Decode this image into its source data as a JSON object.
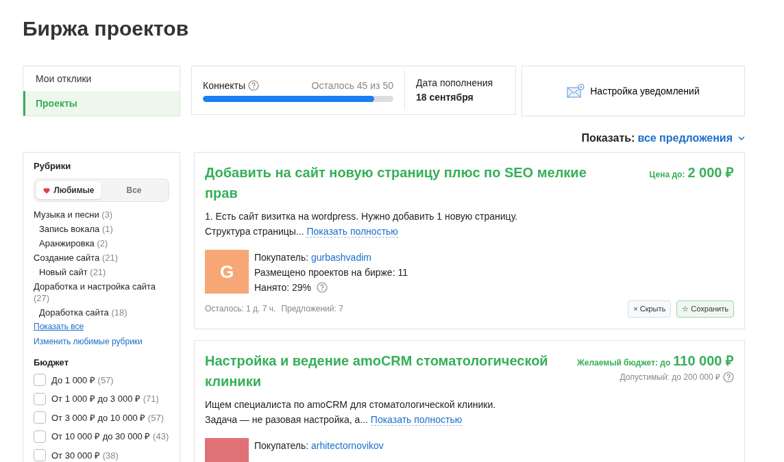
{
  "page_title": "Биржа проектов",
  "menu": [
    {
      "label": "Мои отклики",
      "selected": false
    },
    {
      "label": "Проекты",
      "selected": true
    }
  ],
  "connects": {
    "label": "Коннекты",
    "remaining_label": "Осталось",
    "remaining": "45 из 50",
    "level": 0.9
  },
  "refill": {
    "label": "Дата пополнения",
    "date": "18 сентября"
  },
  "notifications_button": {
    "label": "Настройка уведомлений"
  },
  "show_filter": {
    "label": "Показать:",
    "value": "все предложения"
  },
  "categories": {
    "title": "Рубрики",
    "toggle": [
      {
        "label": "Любимые",
        "selected": true
      },
      {
        "label": "Все",
        "selected": false
      }
    ],
    "items": [
      {
        "label": "Музыка и песни",
        "count": "(3)",
        "children": [
          {
            "label": "Запись вокала",
            "count": "(1)"
          },
          {
            "label": "Аранжировка",
            "count": "(2)"
          }
        ]
      },
      {
        "label": "Создание сайта",
        "count": "(21)",
        "children": [
          {
            "label": "Новый сайт",
            "count": "(21)"
          }
        ]
      },
      {
        "label": "Доработка и настройка сайта",
        "count": "(27)",
        "children": [
          {
            "label": "Доработка сайта",
            "count": "(18)"
          }
        ]
      }
    ],
    "show_all": "Показать все",
    "edit_link": "Изменить любимые рубрики"
  },
  "budget": {
    "title": "Бюджет",
    "options": [
      {
        "label": "До 1 000 ₽",
        "count": "(57)",
        "checked": false
      },
      {
        "label": "От 1 000 ₽ до 3 000 ₽",
        "count": "(71)",
        "checked": false
      },
      {
        "label": "От 3 000 ₽ до 10 000 ₽",
        "count": "(57)",
        "checked": false
      },
      {
        "label": "От 10 000 ₽ до 30 000 ₽",
        "count": "(43)",
        "checked": false
      },
      {
        "label": "От 30 000 ₽",
        "count": "(38)",
        "checked": false
      }
    ]
  },
  "projects": [
    {
      "title": "Добавить на сайт новую страницу плюс по SEO мелкие прав",
      "price_label": "Цена до:",
      "price": "2 000 ₽",
      "description": "1. Есть сайт визитка на wordpress. Нужно добавить 1 новую страницу.\nСтруктура страницы...",
      "more_link": "Показать полностью",
      "avatar_letter": "G",
      "color": "#f7a776",
      "buyer_label": "Покупатель:",
      "buyer": "gurbashvadim",
      "posted": "Размещено проектов на бирже: 11",
      "hired": "Нанято: 29%",
      "remaining": "Осталось: 1 д. 7 ч.",
      "offers": "Предложений: 7",
      "hide_button": "× Скрыть",
      "save_button": "☆ Сохранить"
    },
    {
      "title": "Настройка и ведение amoCRM стоматологической клиники",
      "price_label": "Желаемый бюджет: до",
      "price": "110 000 ₽",
      "allowed": "Допустимый: до 200 000 ₽",
      "description": "Ищем специалиста по amoCRM для стоматологической клиники.\nЗадача — не разовая настройка, а...",
      "more_link": "Показать полностью",
      "color": "#e07277",
      "buyer_label": "Покупатель:",
      "buyer": "arhitectornovikov"
    }
  ]
}
